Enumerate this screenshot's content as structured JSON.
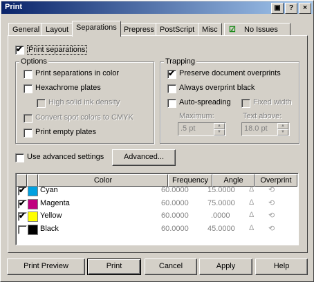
{
  "window": {
    "title": "Print"
  },
  "titlebar_buttons": [
    "?",
    "×"
  ],
  "tabs": [
    "General",
    "Layout",
    "Separations",
    "Prepress",
    "PostScript",
    "Misc",
    "No Issues"
  ],
  "print_separations": {
    "label": "Print separations",
    "checked": true
  },
  "options": {
    "title": "Options",
    "items": [
      {
        "label": "Print separations in color",
        "checked": false,
        "enabled": true
      },
      {
        "label": "Hexachrome plates",
        "checked": false,
        "enabled": true
      },
      {
        "label": "High solid ink density",
        "checked": false,
        "enabled": false
      },
      {
        "label": "Convert spot colors to CMYK",
        "checked": false,
        "enabled": false
      },
      {
        "label": "Print empty plates",
        "checked": false,
        "enabled": true
      }
    ]
  },
  "trapping": {
    "title": "Trapping",
    "preserve": {
      "label": "Preserve document overprints",
      "checked": true
    },
    "always": {
      "label": "Always overprint black",
      "checked": false
    },
    "auto": {
      "label": "Auto-spreading",
      "checked": false
    },
    "fixed": {
      "label": "Fixed width",
      "checked": false
    },
    "maximum_label": "Maximum:",
    "maximum_value": ".5 pt",
    "text_above_label": "Text above:",
    "text_above_value": "18.0 pt"
  },
  "advanced": {
    "label": "Use advanced settings",
    "checked": false,
    "button": "Advanced..."
  },
  "table": {
    "headers": [
      "Color",
      "Frequency",
      "Angle",
      "Overprint"
    ],
    "rows": [
      {
        "checked": true,
        "name": "Cyan",
        "swatch": "#00a0e0",
        "frequency": "60.0000",
        "angle": "15.0000"
      },
      {
        "checked": true,
        "name": "Magenta",
        "swatch": "#c0007e",
        "frequency": "60.0000",
        "angle": "75.0000"
      },
      {
        "checked": true,
        "name": "Yellow",
        "swatch": "#ffff00",
        "frequency": "60.0000",
        "angle": ".0000"
      },
      {
        "checked": false,
        "name": "Black",
        "swatch": "#000000",
        "frequency": "60.0000",
        "angle": "45.0000"
      }
    ]
  },
  "footer": {
    "preview": "Print Preview",
    "print": "Print",
    "cancel": "Cancel",
    "apply": "Apply",
    "help": "Help"
  },
  "marks": {
    "check": "✔"
  }
}
